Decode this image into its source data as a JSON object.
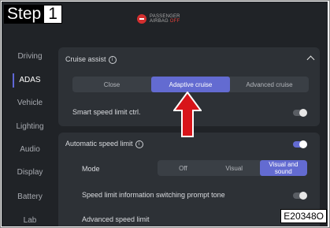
{
  "step": {
    "label": "Step",
    "number": "1"
  },
  "airbag": {
    "line1": "PASSENGER",
    "line2": "AIRBAG",
    "state": "OFF",
    "icon": "airbag-off-icon",
    "color": "#d32f2f"
  },
  "sidebar": {
    "items": [
      {
        "label": "Driving",
        "active": false
      },
      {
        "label": "ADAS",
        "active": true
      },
      {
        "label": "Vehicle",
        "active": false
      },
      {
        "label": "Lighting",
        "active": false
      },
      {
        "label": "Audio",
        "active": false
      },
      {
        "label": "Display",
        "active": false
      },
      {
        "label": "Battery",
        "active": false
      },
      {
        "label": "Lab",
        "active": false
      }
    ]
  },
  "cruise": {
    "title": "Cruise assist",
    "options": [
      "Close",
      "Adaptive cruise",
      "Advanced cruise"
    ],
    "selected": "Adaptive cruise",
    "smart_speed_label": "Smart speed limit ctrl.",
    "smart_speed_on": false
  },
  "auto_speed": {
    "title": "Automatic speed limit",
    "enabled": true,
    "mode_label": "Mode",
    "mode_options": [
      "Off",
      "Visual",
      "Visual and sound"
    ],
    "mode_selected": "Visual and sound",
    "prompt_tone_label": "Speed limit information switching prompt tone",
    "prompt_tone_on": false,
    "advanced_label": "Advanced speed limit"
  },
  "code": "E20348O",
  "colors": {
    "accent": "#636bd1",
    "arrow": "#d8141a",
    "background": "#202327",
    "panel": "#2d3136"
  }
}
